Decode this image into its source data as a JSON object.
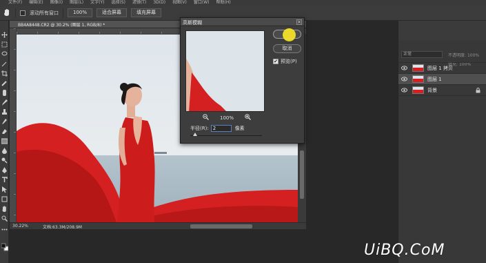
{
  "menubar": {
    "items": [
      "文件(F)",
      "编辑(E)",
      "图像(I)",
      "图层(L)",
      "文字(Y)",
      "选择(S)",
      "滤镜(T)",
      "3D(D)",
      "视图(V)",
      "窗口(W)",
      "帮助(H)"
    ]
  },
  "options": {
    "scroll_all_label": "滚动所有窗口",
    "zoom_button": "100%",
    "fit_button": "适合屏幕",
    "fill_button": "填充屏幕"
  },
  "document": {
    "tab_title": "BB4A8448.CR2 @ 30.2% (图层 1, RGB/8) *",
    "zoom_status": "30.22%",
    "doc_status": "文档:63.3M/208.9M"
  },
  "dialog": {
    "title": "高斯模糊",
    "ok_label": "",
    "cancel_label": "取消",
    "preview_label": "预览(P)",
    "preview_checked": "✔",
    "zoom_out_icon": "zoom-out-icon",
    "zoom_level": "100%",
    "zoom_in_icon": "zoom-in-icon",
    "radius_label": "半径(R):",
    "radius_value": "2",
    "radius_unit": "像素",
    "slider_fraction": 0.04
  },
  "layers_panel": {
    "lock_label": "不透明度:",
    "lock_value": "100%",
    "blend_mode": "正常",
    "fill_label": "填充:",
    "fill_value": "100%",
    "layers": [
      {
        "name": "图层 1 拷贝",
        "selected": false,
        "locked": false
      },
      {
        "name": "图层 1",
        "selected": true,
        "locked": false
      },
      {
        "name": "背景",
        "selected": false,
        "locked": true
      }
    ]
  },
  "watermark": "UiBQ.CoM",
  "colors": {
    "accent_yellow": "#f2df28",
    "dress_red": "#d42020",
    "sky": "#dfe6ec",
    "sea": "#a9bac6",
    "panel_bg": "#383838"
  }
}
